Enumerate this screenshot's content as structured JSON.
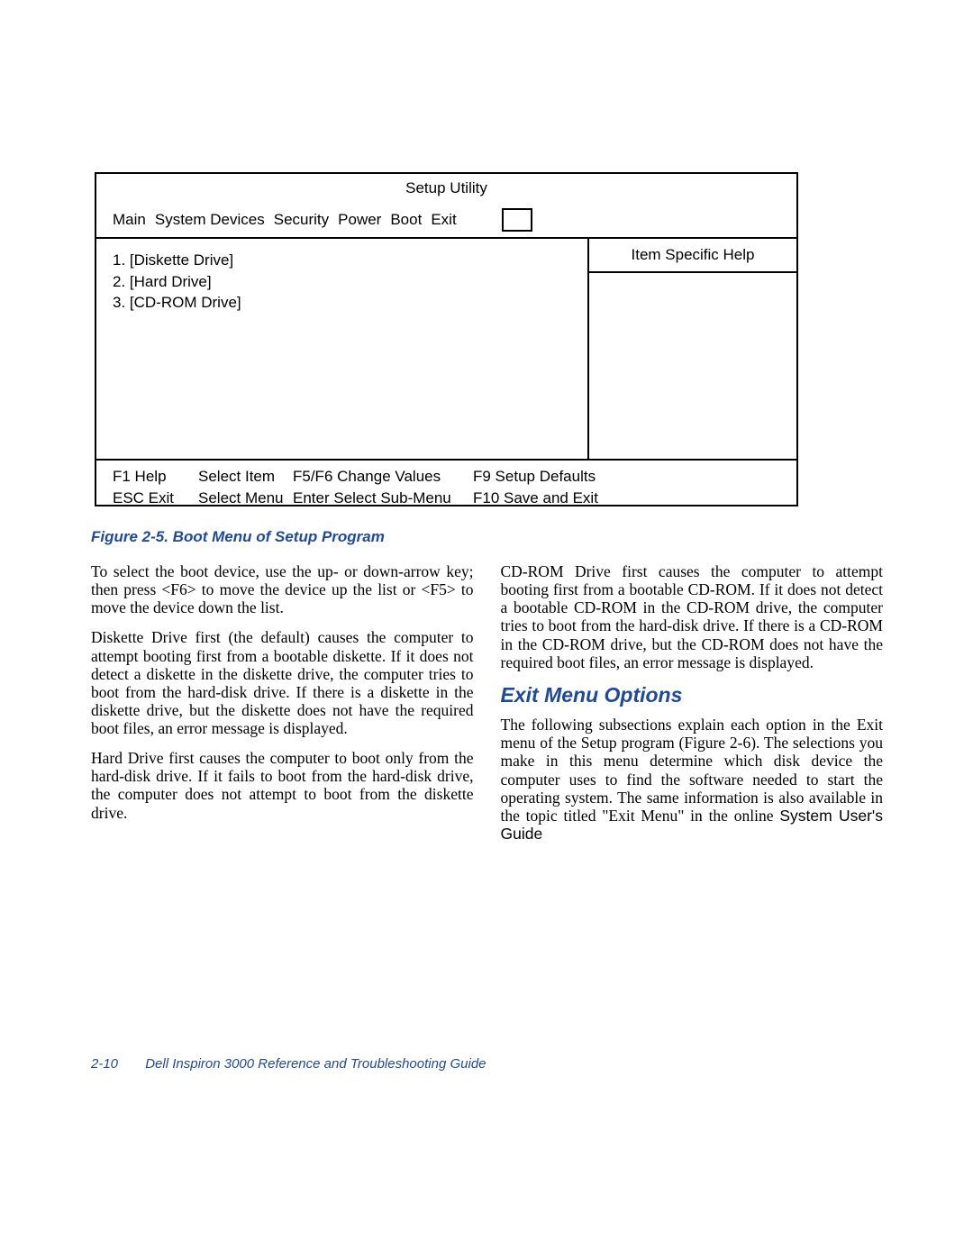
{
  "figure": {
    "title": "Setup Utility",
    "menu": [
      "Main",
      "System Devices",
      "Security",
      "Power",
      "Boot",
      "Exit"
    ],
    "boot_items": [
      "1. [Diskette Drive]",
      "2. [Hard Drive]",
      "3. [CD-ROM Drive]"
    ],
    "help_header": "Item Specific Help",
    "footer_rows": [
      [
        "F1 Help",
        "Select Item",
        "F5/F6 Change Values",
        "F9 Setup Defaults"
      ],
      [
        "ESC Exit",
        "Select Menu",
        "Enter Select  Sub-Menu",
        "F10 Save and Exit"
      ]
    ]
  },
  "caption": "Figure 2-5.  Boot Menu of Setup Program",
  "body": {
    "p1": "To select the boot device, use the up- or down-arrow key; then press <F6> to move the device up the list or <F5> to move the device down the list.",
    "p2": "Diskette Drive first (the default) causes the computer to attempt booting first from a bootable diskette. If it does not detect a diskette in the diskette drive, the computer tries to boot from the hard-disk drive. If there is a diskette in the diskette drive, but the diskette does not have the required boot files, an error message is displayed.",
    "p3": "Hard Drive first causes the computer to boot only from the hard-disk drive. If it fails to boot from the hard-disk drive, the computer does not attempt to boot from the diskette drive.",
    "p4": "CD-ROM Drive first causes the computer to attempt booting first from a bootable CD-ROM. If it does not detect a bootable CD-ROM in the CD-ROM drive, the computer tries to boot from the hard-disk drive. If there is a CD-ROM in the CD-ROM drive, but the CD-ROM does not have the required boot files, an error message is displayed.",
    "heading": "Exit Menu Options",
    "p5a": "The following subsections explain each option in the Exit menu of the Setup program (Figure 2-6). The selections you make in this menu determine which disk device the computer uses to find the software needed to start the operating system. The same information is also available in the topic titled \"Exit Menu\" in the online ",
    "p5b": "System User's Guide"
  },
  "footer": {
    "page": "2-10",
    "title": "Dell Inspiron 3000 Reference and Troubleshooting Guide"
  }
}
